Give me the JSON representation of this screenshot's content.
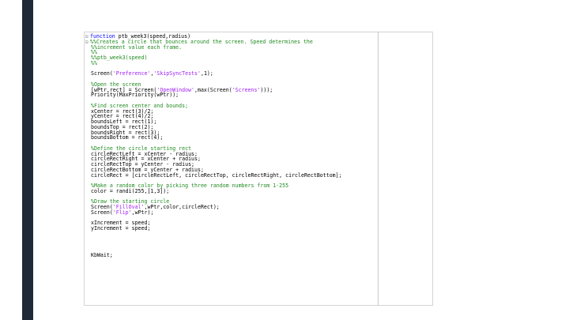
{
  "editor": {
    "lines": [
      {
        "fold": "⊟",
        "parts": [
          {
            "t": "kw",
            "v": "function "
          },
          {
            "t": "tx",
            "v": "ptb_week3(speed,radius)"
          }
        ]
      },
      {
        "fold": "⊟",
        "parts": [
          {
            "t": "cm",
            "v": "%%Creates a circle that bounces around the screen. Speed determines the"
          }
        ]
      },
      {
        "parts": [
          {
            "t": "cm",
            "v": "%%increment value each frame."
          }
        ]
      },
      {
        "parts": [
          {
            "t": "cm",
            "v": "%%"
          }
        ]
      },
      {
        "parts": [
          {
            "t": "cm",
            "v": "%%ptb_week3(speed)"
          }
        ]
      },
      {
        "parts": [
          {
            "t": "cm",
            "v": "%%"
          }
        ]
      },
      {
        "parts": []
      },
      {
        "parts": [
          {
            "t": "tx",
            "v": "Screen("
          },
          {
            "t": "st",
            "v": "'Preference'"
          },
          {
            "t": "tx",
            "v": ","
          },
          {
            "t": "st",
            "v": "'SkipSyncTests'"
          },
          {
            "t": "tx",
            "v": ",1);"
          }
        ]
      },
      {
        "parts": []
      },
      {
        "parts": [
          {
            "t": "cm",
            "v": "%Open the screen"
          }
        ]
      },
      {
        "parts": [
          {
            "t": "tx",
            "v": "[wPtr,rect] = Screen("
          },
          {
            "t": "st",
            "v": "'OpenWindow'"
          },
          {
            "t": "tx",
            "v": ",max(Screen("
          },
          {
            "t": "st",
            "v": "'Screens'"
          },
          {
            "t": "tx",
            "v": ")));"
          }
        ]
      },
      {
        "parts": [
          {
            "t": "tx",
            "v": "Priority(MaxPriority(wPtr));"
          }
        ]
      },
      {
        "parts": []
      },
      {
        "parts": [
          {
            "t": "cm",
            "v": "%Find screen center and bounds;"
          }
        ]
      },
      {
        "parts": [
          {
            "t": "tx",
            "v": "xCenter = rect(3)/2;"
          }
        ]
      },
      {
        "parts": [
          {
            "t": "tx",
            "v": "yCenter = rect(4)/2;"
          }
        ]
      },
      {
        "parts": [
          {
            "t": "tx",
            "v": "boundsLeft = rect(1);"
          }
        ]
      },
      {
        "parts": [
          {
            "t": "tx",
            "v": "boundsTop = rect(2);"
          }
        ]
      },
      {
        "parts": [
          {
            "t": "tx",
            "v": "boundsRight = rect(3);"
          }
        ]
      },
      {
        "parts": [
          {
            "t": "tx",
            "v": "boundsBottom = rect(4);"
          }
        ]
      },
      {
        "parts": []
      },
      {
        "parts": [
          {
            "t": "cm",
            "v": "%Define the circle starting rect"
          }
        ]
      },
      {
        "parts": [
          {
            "t": "tx",
            "v": "circleRectLeft = xCenter - radius;"
          }
        ]
      },
      {
        "parts": [
          {
            "t": "tx",
            "v": "circleRectRight = xCenter + radius;"
          }
        ]
      },
      {
        "parts": [
          {
            "t": "tx",
            "v": "circleRectTop = yCenter - radius;"
          }
        ]
      },
      {
        "parts": [
          {
            "t": "tx",
            "v": "circleRectBottom = yCenter + radius;"
          }
        ]
      },
      {
        "parts": [
          {
            "t": "tx",
            "v": "circleRect = [circleRectLeft, circleRectTop, circleRectRight, circleRectBottom];"
          }
        ]
      },
      {
        "parts": []
      },
      {
        "parts": [
          {
            "t": "cm",
            "v": "%Make a random color by picking three random numbers from 1-255"
          }
        ]
      },
      {
        "parts": [
          {
            "t": "tx",
            "v": "color = randi(255,[1,3]);"
          }
        ]
      },
      {
        "parts": []
      },
      {
        "parts": [
          {
            "t": "cm",
            "v": "%Draw the starting circle"
          }
        ]
      },
      {
        "parts": [
          {
            "t": "tx",
            "v": "Screen("
          },
          {
            "t": "st",
            "v": "'FillOval'"
          },
          {
            "t": "tx",
            "v": ",wPtr,color,circleRect);"
          }
        ]
      },
      {
        "parts": [
          {
            "t": "tx",
            "v": "Screen("
          },
          {
            "t": "st",
            "v": "'Flip'"
          },
          {
            "t": "tx",
            "v": ",wPtr);"
          }
        ]
      },
      {
        "parts": []
      },
      {
        "parts": [
          {
            "t": "tx",
            "v": "xIncrement = speed;"
          }
        ]
      },
      {
        "parts": [
          {
            "t": "tx",
            "v": "yIncrement = speed;"
          }
        ]
      },
      {
        "parts": []
      },
      {
        "parts": []
      },
      {
        "parts": []
      },
      {
        "parts": []
      },
      {
        "parts": [
          {
            "t": "tx",
            "v": "KbWait;"
          }
        ]
      }
    ]
  }
}
